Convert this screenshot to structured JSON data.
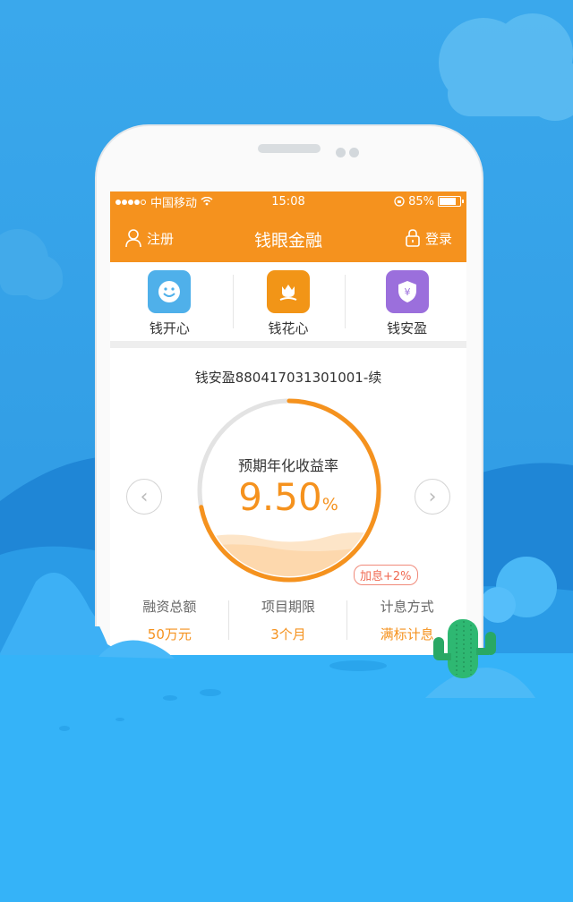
{
  "status_bar": {
    "carrier": "中国移动",
    "time": "15:08",
    "battery": "85%"
  },
  "nav": {
    "register": "注册",
    "title": "钱眼金融",
    "login": "登录"
  },
  "products": [
    {
      "label": "钱开心",
      "color": "#4fb0ea"
    },
    {
      "label": "钱花心",
      "color": "#f29517"
    },
    {
      "label": "钱安盈",
      "color": "#9b6fdc"
    }
  ],
  "product_card": {
    "name": "钱安盈880417031301001-续",
    "bonus": "加息+2%",
    "rate_label": "预期年化收益率",
    "rate_value": "9.50",
    "rate_unit": "%",
    "progress": 0.72,
    "stats": [
      {
        "label": "融资总额",
        "value": "50万元"
      },
      {
        "label": "项目期限",
        "value": "3个月"
      },
      {
        "label": "计息方式",
        "value": "满标计息"
      }
    ]
  },
  "colors": {
    "brand_orange": "#f5921e",
    "sky_blue": "#2f9fe8",
    "ground_blue": "#35b3f8"
  }
}
